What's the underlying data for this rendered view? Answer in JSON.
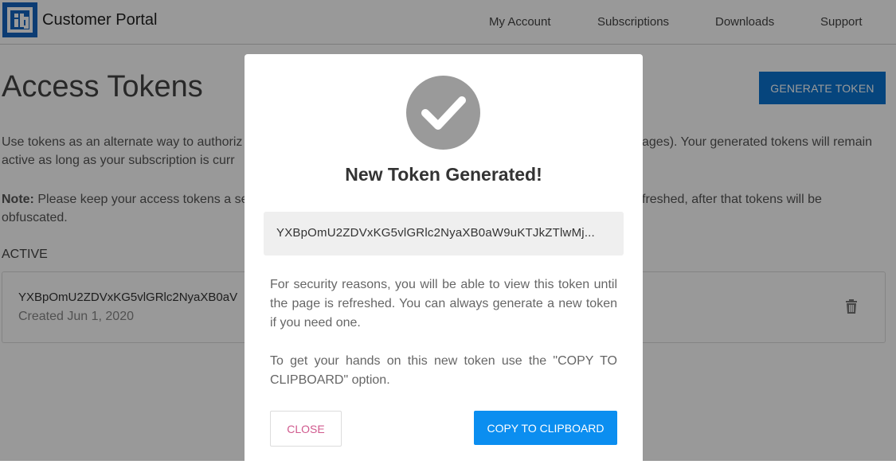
{
  "header": {
    "brand": "Customer Portal",
    "nav": [
      "My Account",
      "Subscriptions",
      "Downloads",
      "Support"
    ]
  },
  "page": {
    "title": "Access Tokens",
    "generate_button": "GENERATE TOKEN",
    "intro_line1_left": "Use tokens as an alternate way to authoriz",
    "intro_line1_right": "ages). Your generated tokens will remain",
    "intro_line2": "active as long as your subscription is curr",
    "note_label": "Note:",
    "note_line1_left": "Please keep your access tokens a se",
    "note_line1_right": "freshed, after that tokens will be",
    "note_line2": "obfuscated.",
    "section_label": "ACTIVE",
    "token": {
      "value": "YXBpOmU2ZDVxKG5vlGRlc2NyaXB0aV",
      "created": "Created Jun 1, 2020"
    }
  },
  "modal": {
    "title": "New Token Generated!",
    "token_value": "YXBpOmU2ZDVxKG5vlGRlc2NyaXB0aW9uKTJkZTlwMj...",
    "security_text": "For security reasons, you will be able to view this token until the page is refreshed. You can always generate a new token if you need one.",
    "copy_text": "To get your hands on this new token use the \"COPY TO CLIPBOARD\" option.",
    "close_button": "CLOSE",
    "copy_button": "COPY TO CLIPBOARD"
  },
  "colors": {
    "primary": "#0b74d1",
    "copy_button": "#0b8ef0",
    "close_text": "#d05a8e",
    "overlay": "rgba(0,0,0,0.40)"
  },
  "icons": {
    "logo": "brand-logo-icon",
    "check": "checkmark-icon",
    "delete": "trash-icon"
  }
}
